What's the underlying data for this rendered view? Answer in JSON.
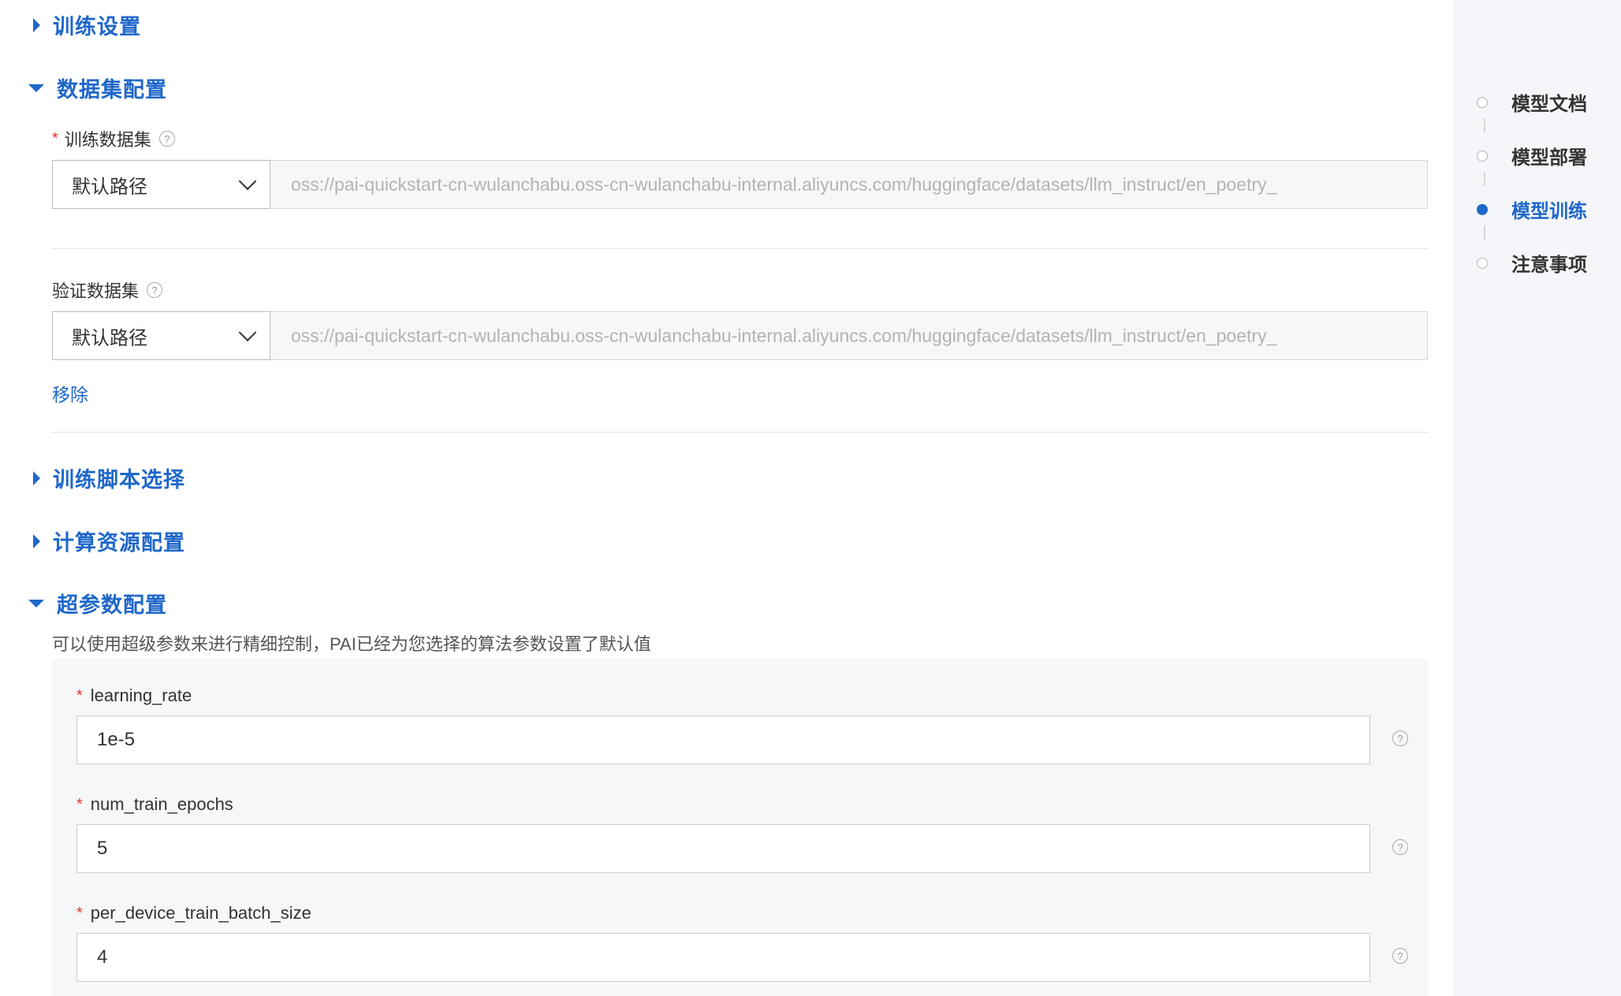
{
  "sections": {
    "training_settings": "训练设置",
    "dataset_config": "数据集配置",
    "training_script": "训练脚本选择",
    "compute_resources": "计算资源配置",
    "hyperparams": "超参数配置"
  },
  "dataset": {
    "train": {
      "required_mark": "*",
      "label": "训练数据集",
      "select_value": "默认路径",
      "path": "oss://pai-quickstart-cn-wulanchabu.oss-cn-wulanchabu-internal.aliyuncs.com/huggingface/datasets/llm_instruct/en_poetry_"
    },
    "validation": {
      "label": "验证数据集",
      "select_value": "默认路径",
      "path": "oss://pai-quickstart-cn-wulanchabu.oss-cn-wulanchabu-internal.aliyuncs.com/huggingface/datasets/llm_instruct/en_poetry_"
    },
    "remove_label": "移除"
  },
  "hyperparams": {
    "description": "可以使用超级参数来进行精细控制，PAI已经为您选择的算法参数设置了默认值",
    "items": [
      {
        "required_mark": "*",
        "name": "learning_rate",
        "value": "1e-5"
      },
      {
        "required_mark": "*",
        "name": "num_train_epochs",
        "value": "5"
      },
      {
        "required_mark": "*",
        "name": "per_device_train_batch_size",
        "value": "4"
      }
    ]
  },
  "help_glyph": "?",
  "sidebar_nav": {
    "items": [
      {
        "label": "模型文档",
        "active": false
      },
      {
        "label": "模型部署",
        "active": false
      },
      {
        "label": "模型训练",
        "active": true
      },
      {
        "label": "注意事项",
        "active": false
      }
    ]
  },
  "colors": {
    "accent": "#1f67c9",
    "required": "#e0362c",
    "sidebar_bg": "#f5f6f9",
    "panel_bg": "#f6f7f9"
  }
}
